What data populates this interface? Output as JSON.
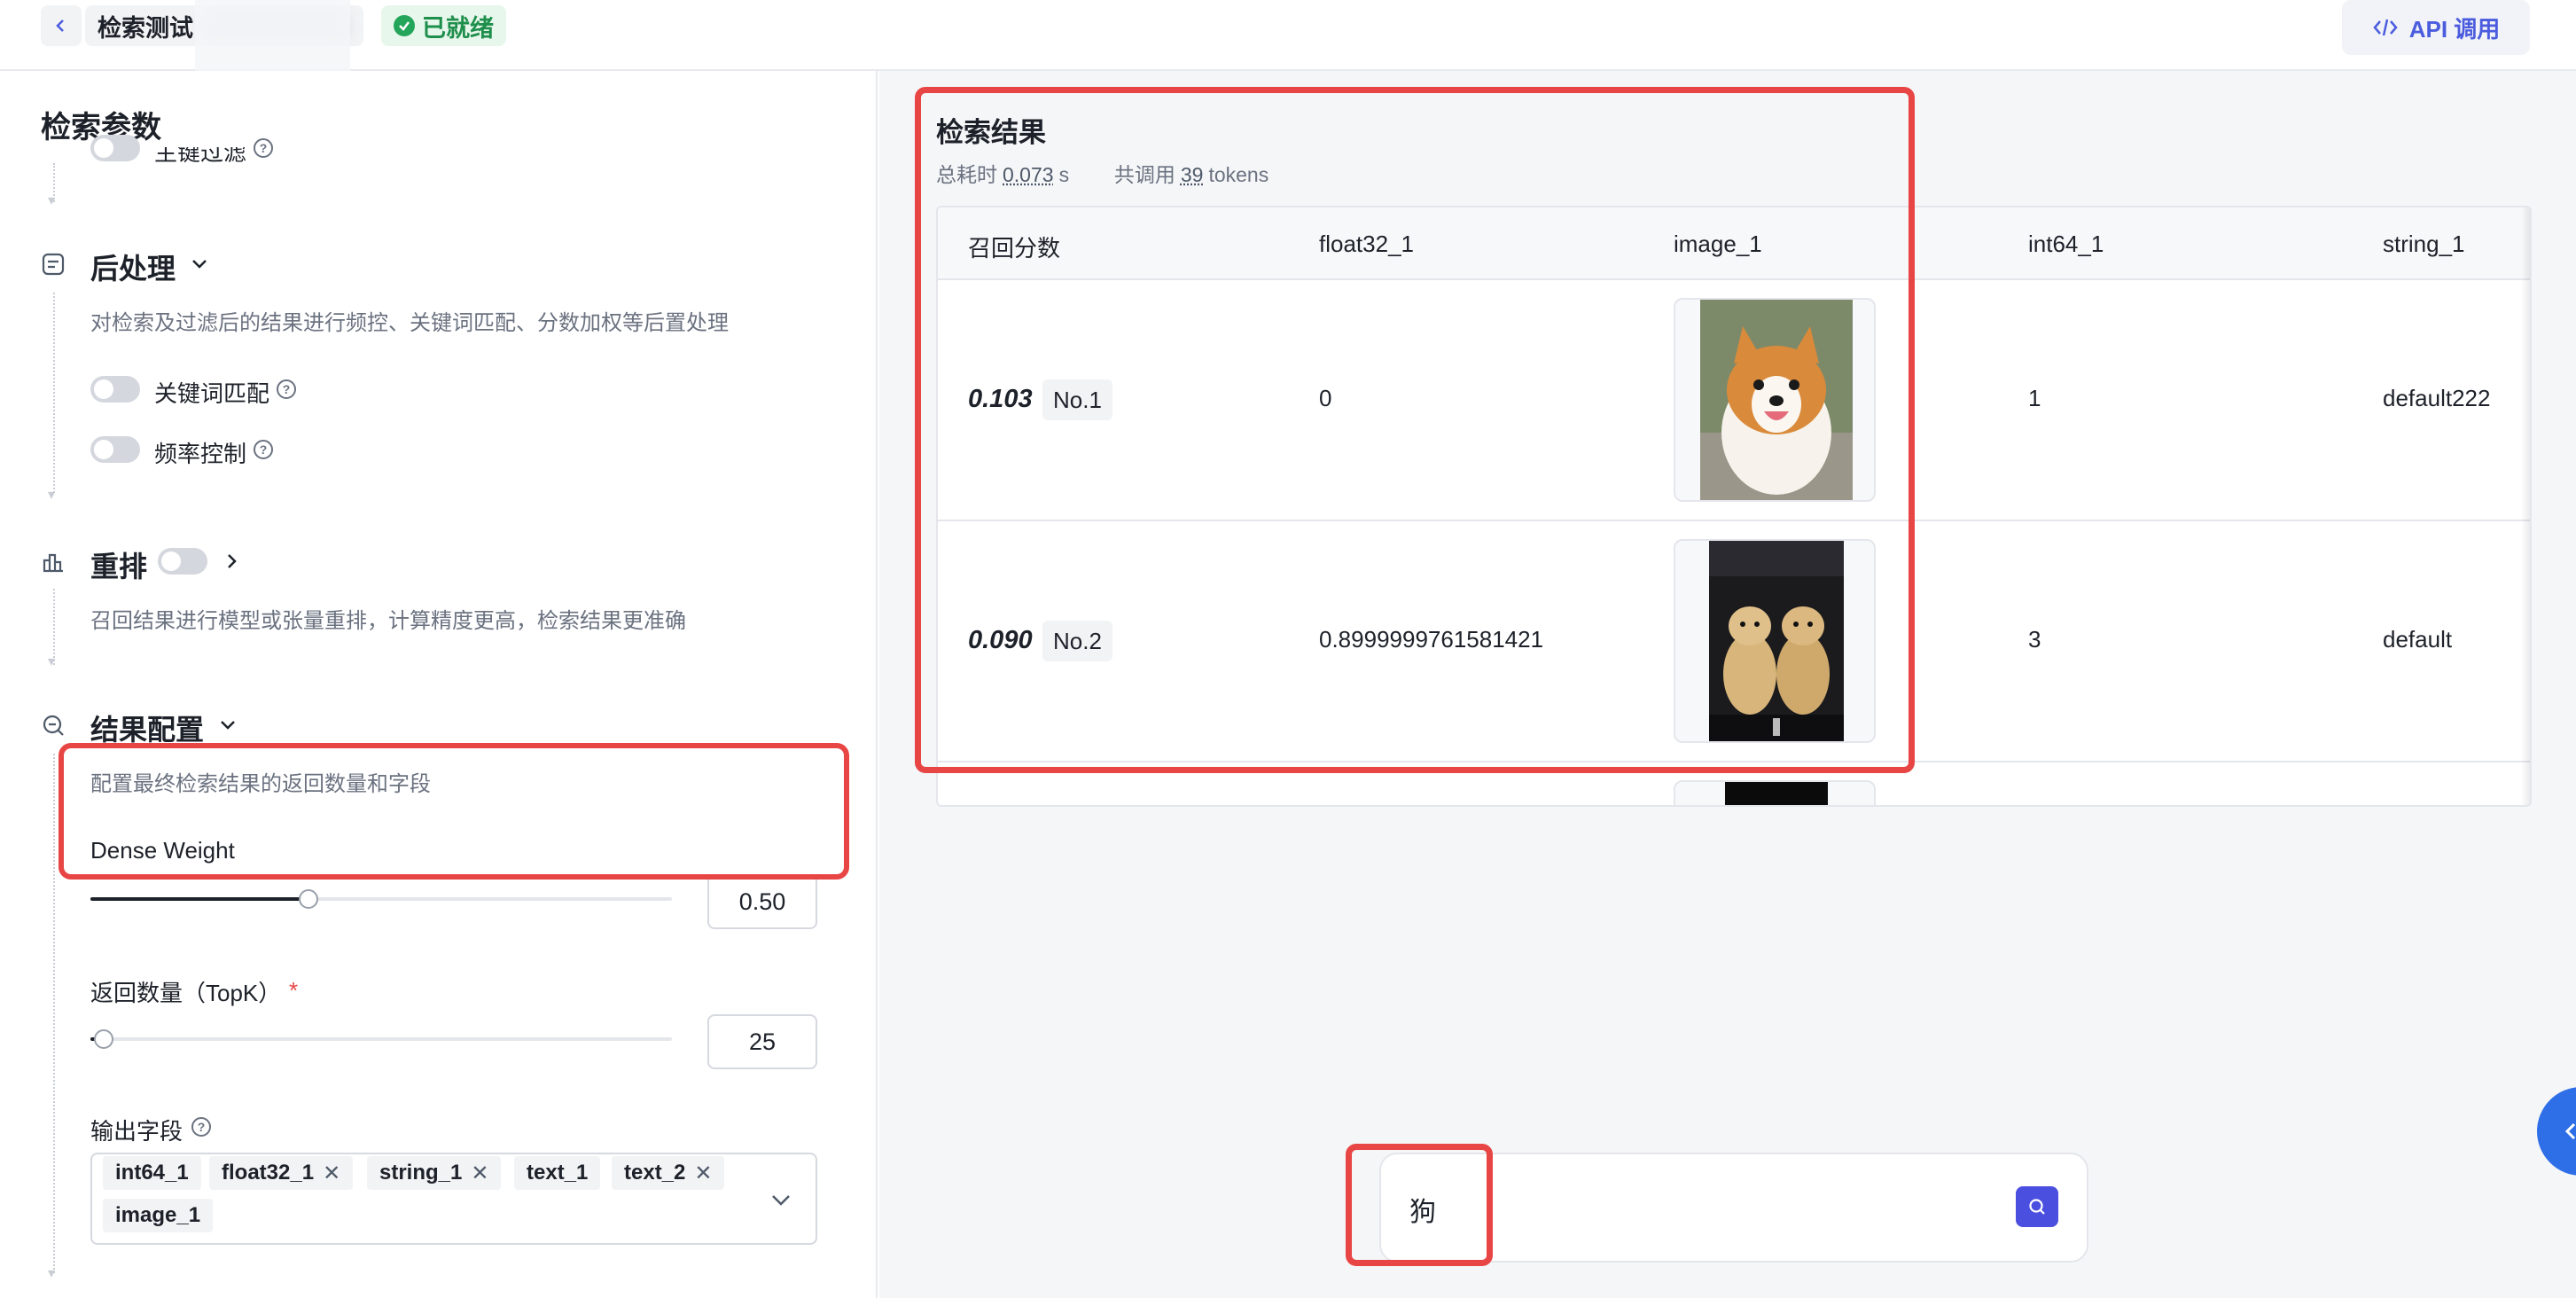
{
  "header": {
    "back_label": "",
    "title": "检索测试",
    "status": "已就绪",
    "api_button": "API 调用"
  },
  "params": {
    "title": "检索参数",
    "scalar_filter_label": "主键过滤",
    "post_processing": {
      "title": "后处理",
      "desc": "对检索及过滤后的结果进行频控、关键词匹配、分数加权等后置处理",
      "keyword_match_label": "关键词匹配",
      "frequency_control_label": "频率控制"
    },
    "rerank": {
      "title": "重排",
      "desc": "召回结果进行模型或张量重排，计算精度更高，检索结果更准确"
    },
    "result_config": {
      "title": "结果配置",
      "desc": "配置最终检索结果的返回数量和字段",
      "dense_weight_label": "Dense Weight",
      "dense_weight_value": "0.50",
      "dense_weight_fraction": 0.5,
      "topk_label": "返回数量（TopK）",
      "topk_value": "25",
      "output_fields_label": "输出字段",
      "output_fields": [
        "int64_1",
        "float32_1",
        "string_1",
        "text_1",
        "text_2",
        "image_1"
      ]
    }
  },
  "results": {
    "title": "检索结果",
    "time_label": "总耗时",
    "time_value": "0.073",
    "time_unit": "s",
    "tokens_label": "共调用",
    "tokens_value": "39",
    "tokens_unit": "tokens",
    "columns": [
      "召回分数",
      "float32_1",
      "image_1",
      "int64_1",
      "string_1"
    ],
    "rows": [
      {
        "score": "0.103",
        "rank": "No.1",
        "float32_1": "0",
        "image": "corgi-photo",
        "int64_1": "1",
        "string_1": "default222"
      },
      {
        "score": "0.090",
        "rank": "No.2",
        "float32_1": "0.8999999761581421",
        "image": "golden-puppies-photo",
        "int64_1": "3",
        "string_1": "default"
      }
    ]
  },
  "search": {
    "query": "狗"
  },
  "colors": {
    "accent": "#4b4fe0",
    "highlight": "#e84545",
    "ready_green": "#23a55a"
  }
}
